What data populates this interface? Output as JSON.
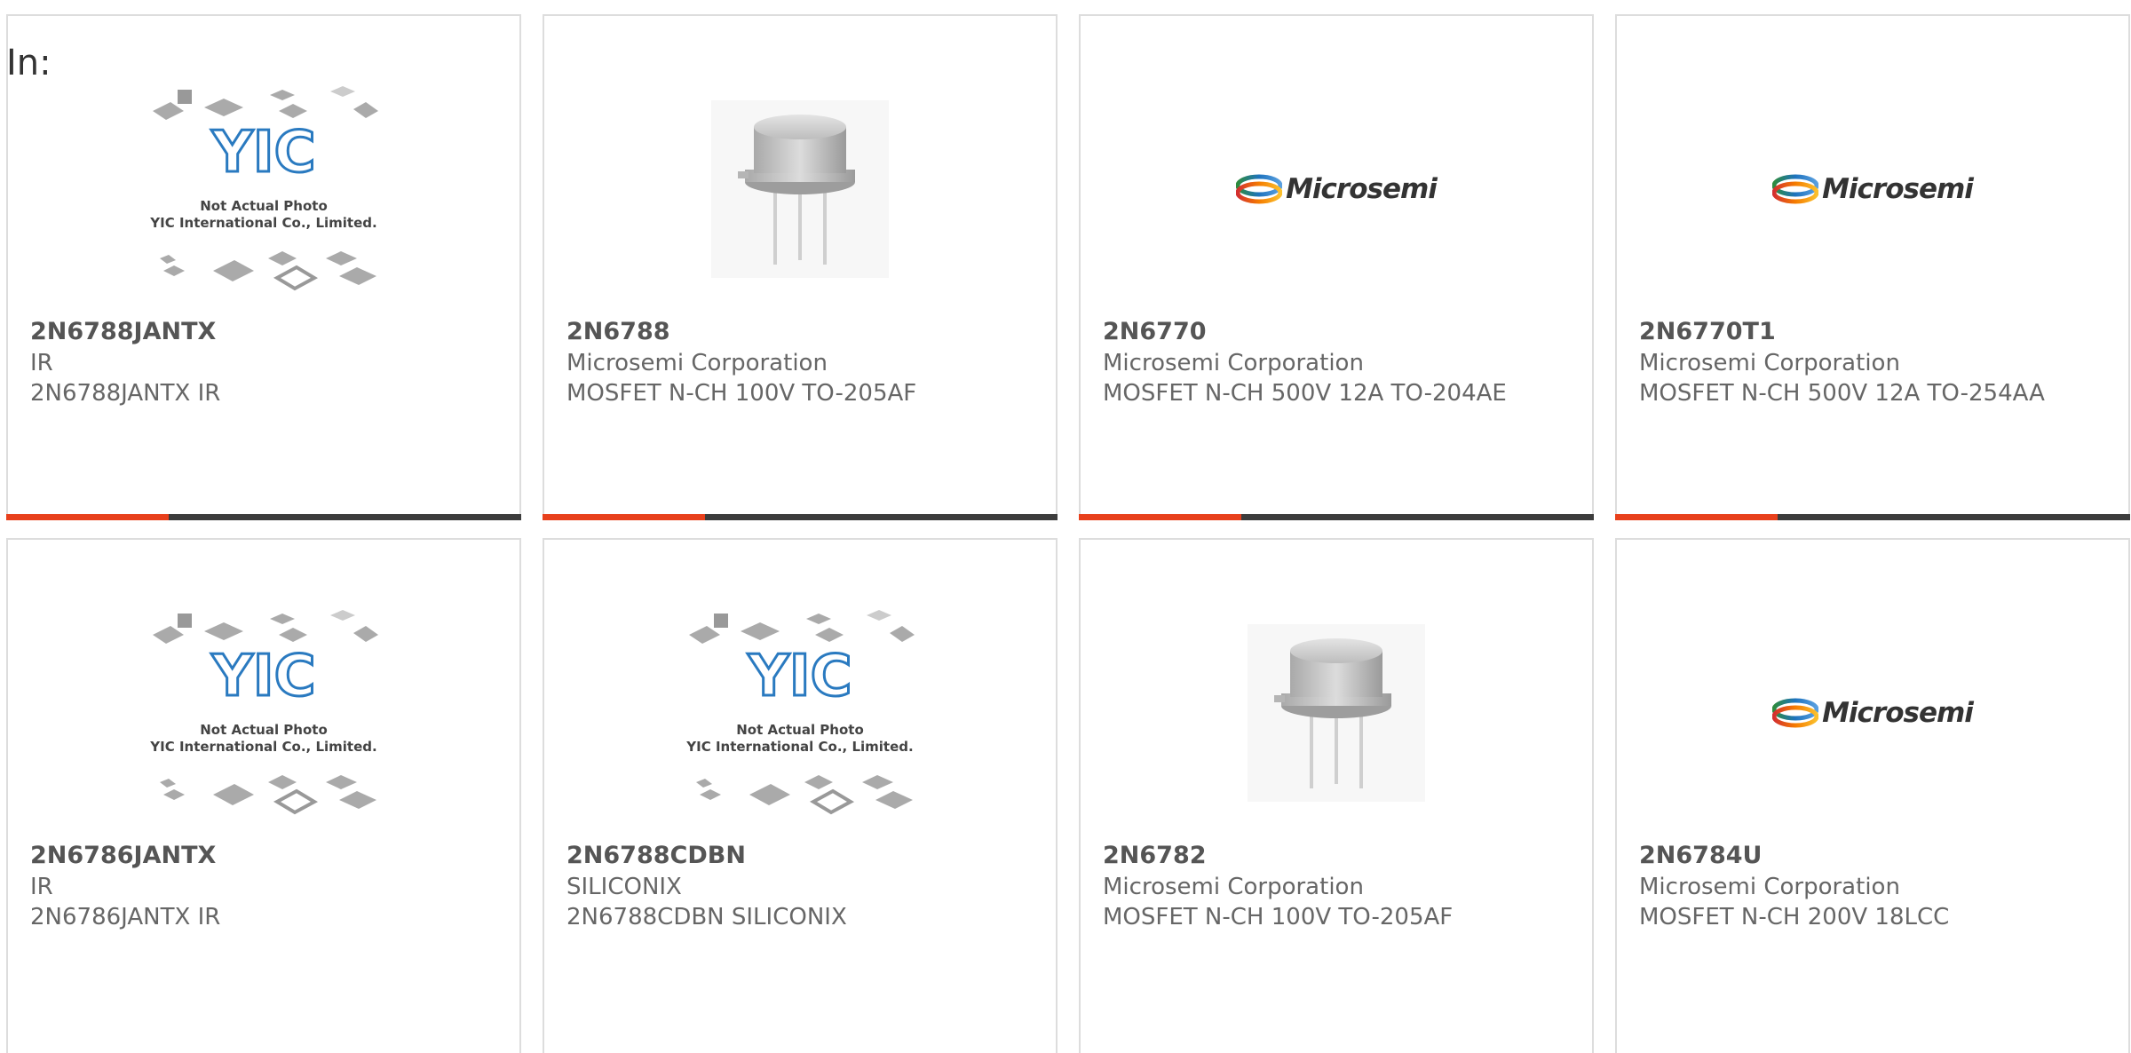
{
  "page": {
    "in_label": "In:"
  },
  "placeholder": {
    "logo_text": "YIC",
    "line1": "Not Actual Photo",
    "line2": "YIC International Co., Limited."
  },
  "brand_logo": {
    "text": "Microsemi"
  },
  "colors": {
    "accent": "#e8401c",
    "bar_dark": "#3c3c3c",
    "border": "#dddddd",
    "text": "#666666"
  },
  "products": [
    {
      "part": "2N6788JANTX",
      "manufacturer": "IR",
      "description": "2N6788JANTX IR",
      "image": "yic-placeholder"
    },
    {
      "part": "2N6788",
      "manufacturer": "Microsemi Corporation",
      "description": "MOSFET N-CH 100V TO-205AF",
      "image": "to-can-transistor"
    },
    {
      "part": "2N6770",
      "manufacturer": "Microsemi Corporation",
      "description": "MOSFET N-CH 500V 12A TO-204AE",
      "image": "microsemi-logo"
    },
    {
      "part": "2N6770T1",
      "manufacturer": "Microsemi Corporation",
      "description": "MOSFET N-CH 500V 12A TO-254AA",
      "image": "microsemi-logo"
    },
    {
      "part": "2N6786JANTX",
      "manufacturer": "IR",
      "description": "2N6786JANTX IR",
      "image": "yic-placeholder"
    },
    {
      "part": "2N6788CDBN",
      "manufacturer": "SILICONIX",
      "description": "2N6788CDBN SILICONIX",
      "image": "yic-placeholder"
    },
    {
      "part": "2N6782",
      "manufacturer": "Microsemi Corporation",
      "description": "MOSFET N-CH 100V TO-205AF",
      "image": "to-can-transistor"
    },
    {
      "part": "2N6784U",
      "manufacturer": "Microsemi Corporation",
      "description": "MOSFET N-CH 200V 18LCC",
      "image": "microsemi-logo"
    }
  ]
}
